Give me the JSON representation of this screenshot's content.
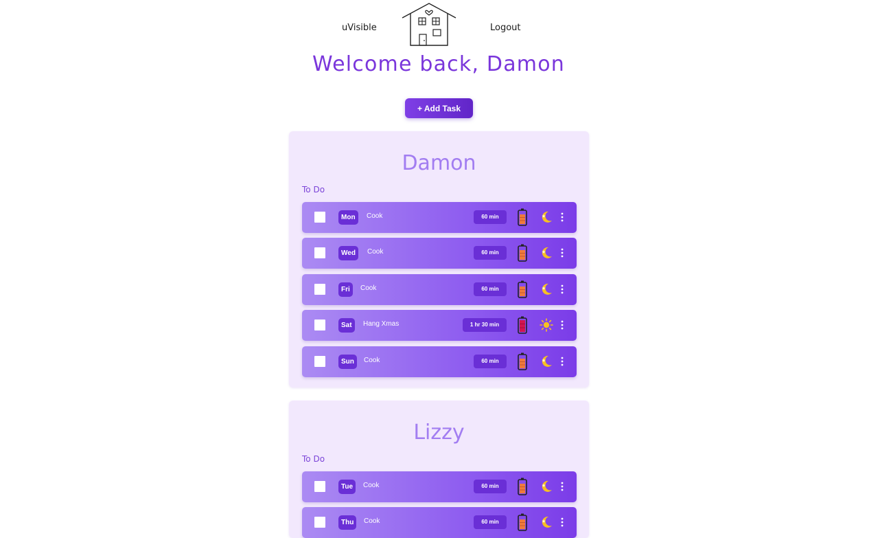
{
  "nav": {
    "brand": "uVisible",
    "logout": "Logout"
  },
  "welcome": "Welcome back, Damon",
  "add_task_label": "+ Add Task",
  "colors": {
    "accent": "#7a36db",
    "card_bg": "#f2e8fd",
    "battery_low": "#d2154f",
    "battery_mid": "#f07a3c",
    "time_of_day": "#f7c023"
  },
  "members": [
    {
      "name": "Damon",
      "section_label": "To Do",
      "tasks": [
        {
          "day": "Mon",
          "name": "Cook",
          "duration": "60 min",
          "energy": "battery-mid-icon",
          "time_of_day": "moon-icon"
        },
        {
          "day": "Wed",
          "name": "Cook",
          "duration": "60 min",
          "energy": "battery-mid-icon",
          "time_of_day": "moon-icon"
        },
        {
          "day": "Fri",
          "name": "Cook",
          "duration": "60 min",
          "energy": "battery-mid-icon",
          "time_of_day": "moon-icon"
        },
        {
          "day": "Sat",
          "name": "Hang Xmas",
          "duration": "1 hr 30 min",
          "energy": "battery-low-icon",
          "time_of_day": "sun-icon"
        },
        {
          "day": "Sun",
          "name": "Cook",
          "duration": "60 min",
          "energy": "battery-mid-icon",
          "time_of_day": "moon-icon"
        }
      ]
    },
    {
      "name": "Lizzy",
      "section_label": "To Do",
      "tasks": [
        {
          "day": "Tue",
          "name": "Cook",
          "duration": "60 min",
          "energy": "battery-mid-icon",
          "time_of_day": "moon-icon"
        },
        {
          "day": "Thu",
          "name": "Cook",
          "duration": "60 min",
          "energy": "battery-mid-icon",
          "time_of_day": "moon-icon"
        }
      ]
    }
  ]
}
